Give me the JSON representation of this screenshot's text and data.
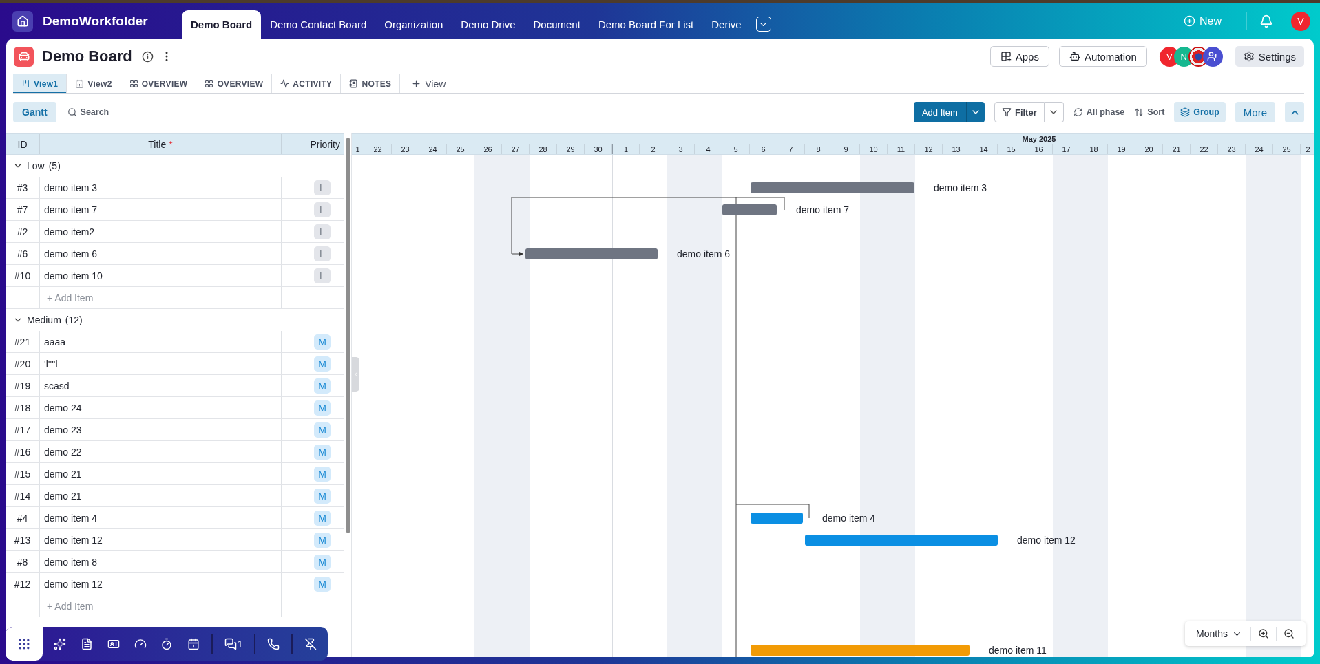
{
  "topbar": {
    "workspace": "DemoWorkfolder",
    "tabs": [
      {
        "label": "Demo Board",
        "selected": true
      },
      {
        "label": "Demo Contact Board",
        "selected": false
      },
      {
        "label": "Organization",
        "selected": false
      },
      {
        "label": "Demo Drive",
        "selected": false
      },
      {
        "label": "Document",
        "selected": false
      },
      {
        "label": "Demo Board For List",
        "selected": false
      },
      {
        "label": "Derive",
        "selected": false
      }
    ],
    "new_label": "New",
    "user_avatar": "V"
  },
  "board": {
    "title": "Demo Board",
    "apps": "Apps",
    "automation": "Automation",
    "settings": "Settings",
    "members": [
      {
        "kind": "initial",
        "initial": "V",
        "color": "#f0262e"
      },
      {
        "kind": "initial",
        "initial": "N",
        "color": "#16b890"
      },
      {
        "kind": "picture"
      },
      {
        "kind": "add",
        "color": "#4a4fd1"
      }
    ]
  },
  "views": [
    {
      "kind": "gantt",
      "label": "View1",
      "selected": true
    },
    {
      "kind": "calendar",
      "label": "View2",
      "selected": false
    },
    {
      "kind": "overview",
      "label": "OVERVIEW",
      "selected": false
    },
    {
      "kind": "overview",
      "label": "OVERVIEW",
      "selected": false
    },
    {
      "kind": "activity",
      "label": "ACTIVITY",
      "selected": false
    },
    {
      "kind": "notes",
      "label": "NOTES",
      "selected": false
    },
    {
      "kind": "add",
      "label": "View",
      "selected": false
    }
  ],
  "toolbar": {
    "view": "Gantt",
    "search": "Search",
    "add": "Add Item",
    "filter": "Filter",
    "phase": "All phase",
    "sort": "Sort",
    "group": "Group",
    "more": "More"
  },
  "table": {
    "columns": [
      "ID",
      "Title",
      "Priority"
    ],
    "required_mark": "*",
    "groups": [
      {
        "kind": "low",
        "name": "Low",
        "count": "(5)",
        "expanded": true,
        "add_label": "+ Add Item",
        "rows": [
          {
            "id": "#3",
            "title": "demo item 3",
            "priority": "L"
          },
          {
            "id": "#7",
            "title": "demo item 7",
            "priority": "L"
          },
          {
            "id": "#2",
            "title": "demo item2",
            "priority": "L"
          },
          {
            "id": "#6",
            "title": "demo item 6",
            "priority": "L"
          },
          {
            "id": "#10",
            "title": "demo item 10",
            "priority": "L"
          }
        ]
      },
      {
        "kind": "medium",
        "name": "Medium",
        "count": "(12)",
        "expanded": true,
        "add_label": "+ Add Item",
        "rows": [
          {
            "id": "#21",
            "title": "aaaa",
            "priority": "M"
          },
          {
            "id": "#20",
            "title": "'l''''l",
            "priority": "M"
          },
          {
            "id": "#19",
            "title": "scasd",
            "priority": "M"
          },
          {
            "id": "#18",
            "title": "demo 24",
            "priority": "M"
          },
          {
            "id": "#17",
            "title": "demo 23",
            "priority": "M"
          },
          {
            "id": "#16",
            "title": "demo 22",
            "priority": "M"
          },
          {
            "id": "#15",
            "title": "demo 21",
            "priority": "M"
          },
          {
            "id": "#14",
            "title": "demo 21",
            "priority": "M"
          },
          {
            "id": "#4",
            "title": "demo item 4",
            "priority": "M"
          },
          {
            "id": "#13",
            "title": "demo item 12",
            "priority": "M"
          },
          {
            "id": "#8",
            "title": "demo item 8",
            "priority": "M"
          },
          {
            "id": "#12",
            "title": "demo item 12",
            "priority": "M"
          }
        ]
      }
    ]
  },
  "gantt": {
    "month": "May 2025",
    "scale": "Months",
    "days": [
      {
        "label": "1",
        "weekend": false,
        "month_start": false
      },
      {
        "label": "22",
        "weekend": false,
        "month_start": false
      },
      {
        "label": "23",
        "weekend": false,
        "month_start": false
      },
      {
        "label": "24",
        "weekend": false,
        "month_start": false
      },
      {
        "label": "25",
        "weekend": false,
        "month_start": false
      },
      {
        "label": "26",
        "weekend": true,
        "month_start": false
      },
      {
        "label": "27",
        "weekend": true,
        "month_start": false
      },
      {
        "label": "28",
        "weekend": false,
        "month_start": false
      },
      {
        "label": "29",
        "weekend": false,
        "month_start": false
      },
      {
        "label": "30",
        "weekend": false,
        "month_start": false
      },
      {
        "label": "1",
        "weekend": false,
        "month_start": true
      },
      {
        "label": "2",
        "weekend": false,
        "month_start": false
      },
      {
        "label": "3",
        "weekend": true,
        "month_start": false
      },
      {
        "label": "4",
        "weekend": true,
        "month_start": false
      },
      {
        "label": "5",
        "weekend": false,
        "month_start": false
      },
      {
        "label": "6",
        "weekend": false,
        "month_start": false
      },
      {
        "label": "7",
        "weekend": false,
        "month_start": false
      },
      {
        "label": "8",
        "weekend": false,
        "month_start": false
      },
      {
        "label": "9",
        "weekend": false,
        "month_start": false
      },
      {
        "label": "10",
        "weekend": true,
        "month_start": false
      },
      {
        "label": "11",
        "weekend": true,
        "month_start": false
      },
      {
        "label": "12",
        "weekend": false,
        "month_start": false
      },
      {
        "label": "13",
        "weekend": false,
        "month_start": false
      },
      {
        "label": "14",
        "weekend": false,
        "month_start": false
      },
      {
        "label": "15",
        "weekend": false,
        "month_start": false
      },
      {
        "label": "16",
        "weekend": false,
        "month_start": false
      },
      {
        "label": "17",
        "weekend": true,
        "month_start": false
      },
      {
        "label": "18",
        "weekend": true,
        "month_start": false
      },
      {
        "label": "19",
        "weekend": false,
        "month_start": false
      },
      {
        "label": "20",
        "weekend": false,
        "month_start": false
      },
      {
        "label": "21",
        "weekend": false,
        "month_start": false
      },
      {
        "label": "22",
        "weekend": false,
        "month_start": false
      },
      {
        "label": "23",
        "weekend": false,
        "month_start": false
      },
      {
        "label": "24",
        "weekend": true,
        "month_start": false
      },
      {
        "label": "25",
        "weekend": true,
        "month_start": false
      },
      {
        "label": "2",
        "weekend": false,
        "month_start": false
      }
    ],
    "bars": [
      {
        "label": "demo item 3",
        "color": "#6f7582"
      },
      {
        "label": "demo item 7",
        "color": "#6f7582"
      },
      {
        "label": "demo item 6",
        "color": "#6f7582"
      },
      {
        "label": "demo item 4",
        "color": "#0b8fe3"
      },
      {
        "label": "demo item 12",
        "color": "#0b8fe3"
      },
      {
        "label": "demo item 11",
        "color": "#f29b05"
      }
    ]
  },
  "dock": {
    "chat_count": "1"
  }
}
